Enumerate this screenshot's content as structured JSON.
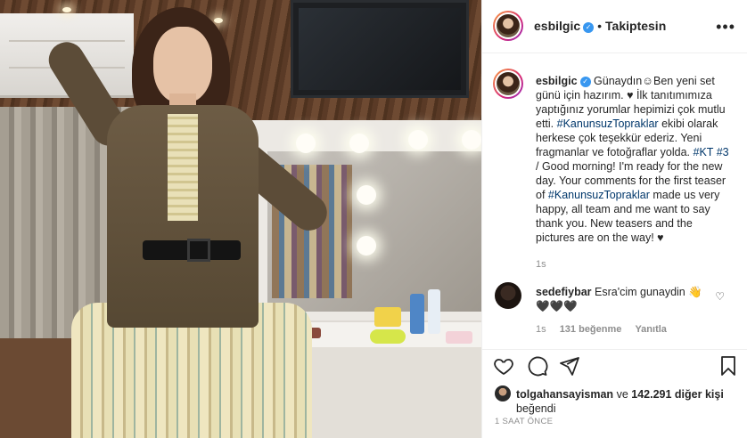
{
  "post": {
    "photo_alt": ""
  },
  "header": {
    "username": "esbilgic",
    "separator": "•",
    "follow_status": "Takiptesin",
    "more_icon": "ellipsis-icon"
  },
  "caption": {
    "username": "esbilgic",
    "text_part1": "Günaydın☺Ben yeni set günü için hazırım. ♥ İlk tanıtımımıza yaptığınız yorumlar hepimizi çok mutlu etti.",
    "hashtag1": "#KanunsuzTopraklar",
    "text_part2": "ekibi olarak herkese çok teşekkür ederiz. Yeni fragmanlar ve fotoğraflar yolda.",
    "hashtag2": "#KT",
    "hashtag3": "#3",
    "text_part3": "/ Good morning! I'm ready for the new day. Your comments for the first teaser of",
    "hashtag4": "#KanunsuzTopraklar",
    "text_part4": "made us very happy, all team and me want to say thank you. New teasers and the pictures are on the way! ♥",
    "time": "1s"
  },
  "reply": {
    "username": "sedefiybar",
    "text": "Esra'cim gunaydin 👋🖤🖤🖤",
    "time": "1s",
    "likes": "131 beğenme",
    "reply_label": "Yanıtla"
  },
  "likes": {
    "first_user": "tolgahansayisman",
    "connector": "ve",
    "others": "142.291 diğer kişi",
    "suffix": "beğendi"
  },
  "timestamp": "1 SAAT ÖNCE",
  "colors": {
    "verified": "#3897f0",
    "hashtag": "#00376b",
    "meta": "#8e8e8e"
  }
}
